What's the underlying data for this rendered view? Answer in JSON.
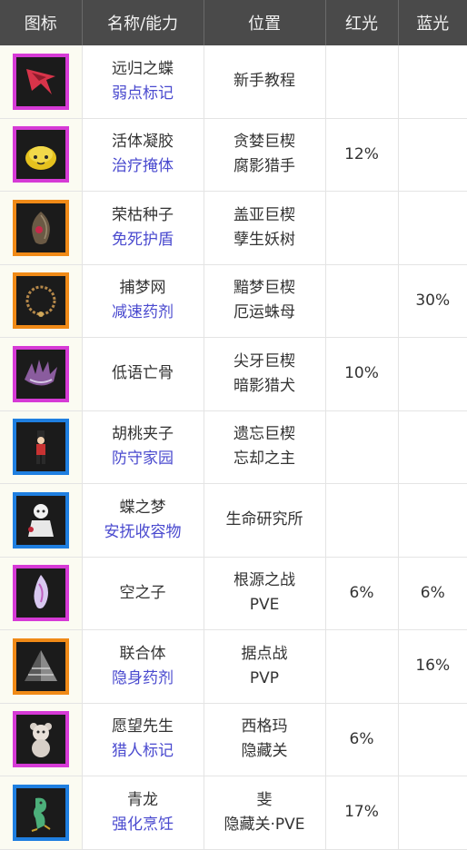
{
  "headers": {
    "icon": "图标",
    "name": "名称/能力",
    "location": "位置",
    "red": "红光",
    "blue": "蓝光"
  },
  "rows": [
    {
      "icon": "red-arrow-butterfly-icon",
      "frame": "purple",
      "name": "远归之蝶",
      "ability": "弱点标记",
      "loc1": "新手教程",
      "loc2": "",
      "red": "",
      "blue": ""
    },
    {
      "icon": "yellow-slime-icon",
      "frame": "purple",
      "name": "活体凝胶",
      "ability": "治疗掩体",
      "loc1": "贪婪巨楔",
      "loc2": "腐影猎手",
      "red": "12%",
      "blue": ""
    },
    {
      "icon": "seed-pod-icon",
      "frame": "orange",
      "name": "荣枯种子",
      "ability": "免死护盾",
      "loc1": "盖亚巨楔",
      "loc2": "孽生妖树",
      "red": "",
      "blue": ""
    },
    {
      "icon": "dreamcatcher-necklace-icon",
      "frame": "orange",
      "name": "捕梦网",
      "ability": "减速药剂",
      "loc1": "黯梦巨楔",
      "loc2": "厄运蛛母",
      "red": "",
      "blue": "30%"
    },
    {
      "icon": "spiky-bone-creature-icon",
      "frame": "purple",
      "name": "低语亡骨",
      "ability": "",
      "loc1": "尖牙巨楔",
      "loc2": "暗影猎犬",
      "red": "10%",
      "blue": ""
    },
    {
      "icon": "nutcracker-icon",
      "frame": "blue",
      "name": "胡桃夹子",
      "ability": "防守家园",
      "loc1": "遗忘巨楔",
      "loc2": "忘却之主",
      "red": "",
      "blue": ""
    },
    {
      "icon": "doll-icon",
      "frame": "blue",
      "name": "蝶之梦",
      "ability": "安抚收容物",
      "loc1": "生命研究所",
      "loc2": "",
      "red": "",
      "blue": ""
    },
    {
      "icon": "ghost-wisp-icon",
      "frame": "purple",
      "name": "空之子",
      "ability": "",
      "loc1": "根源之战",
      "loc2": "PVE",
      "red": "6%",
      "blue": "6%"
    },
    {
      "icon": "pyramid-icon",
      "frame": "orange",
      "name": "联合体",
      "ability": "隐身药剂",
      "loc1": "据点战",
      "loc2": "PVP",
      "red": "",
      "blue": "16%"
    },
    {
      "icon": "teddy-bear-icon",
      "frame": "purple",
      "name": "愿望先生",
      "ability": "猎人标记",
      "loc1": "西格玛",
      "loc2": "隐藏关",
      "red": "6%",
      "blue": ""
    },
    {
      "icon": "green-dragon-icon",
      "frame": "blue",
      "name": "青龙",
      "ability": "强化烹饪",
      "loc1": "斐",
      "loc2": "隐藏关·PVE",
      "red": "17%",
      "blue": ""
    }
  ]
}
